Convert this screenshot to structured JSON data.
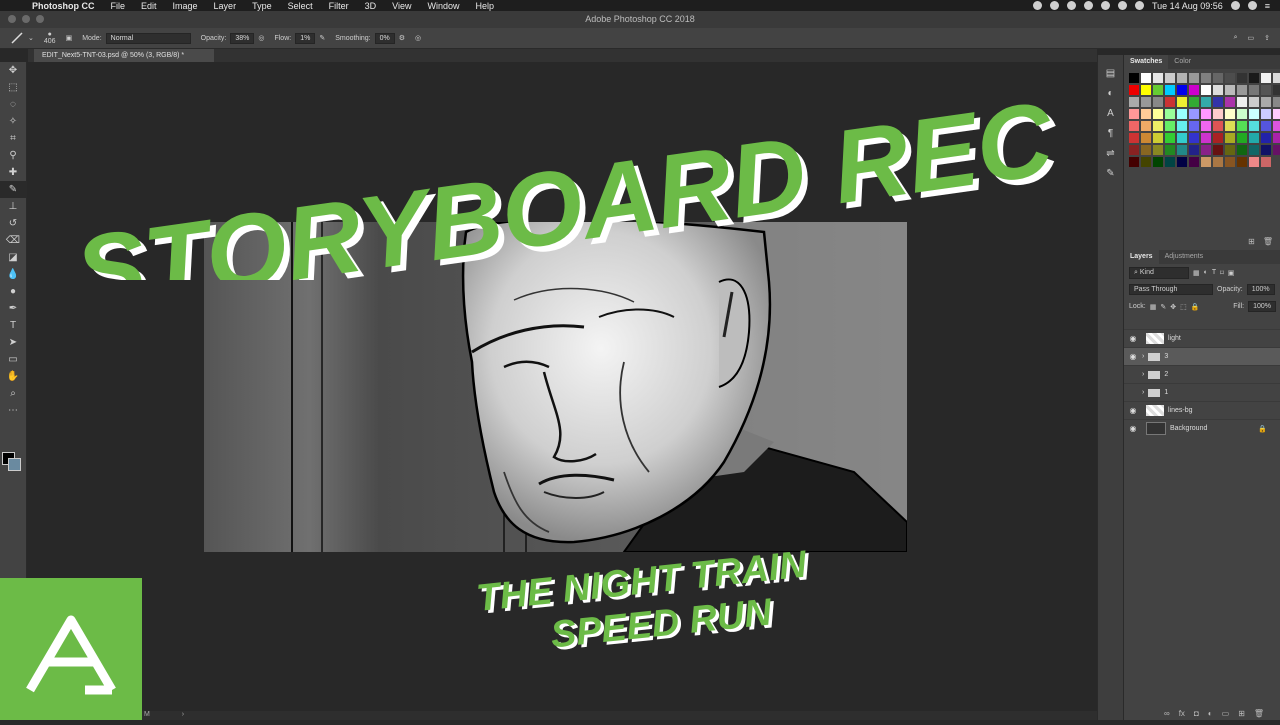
{
  "menubar": {
    "apple_icon": "apple-icon",
    "items": [
      "Photoshop CC",
      "File",
      "Edit",
      "Image",
      "Layer",
      "Type",
      "Select",
      "Filter",
      "3D",
      "View",
      "Window",
      "Help"
    ],
    "clock": "Tue 14 Aug  09:56"
  },
  "window": {
    "title": "Adobe Photoshop CC 2018"
  },
  "options": {
    "brush_size": "406",
    "mode_label": "Mode:",
    "mode_value": "Normal",
    "opacity_label": "Opacity:",
    "opacity_value": "38%",
    "flow_label": "Flow:",
    "flow_value": "1%",
    "smoothing_label": "Smoothing:",
    "smoothing_value": "0%"
  },
  "document": {
    "tab_label": "EDIT_Next5-TNT-03.psd @ 50% (3, RGB/8) *"
  },
  "overlay": {
    "headline": "STORYBOARD REC",
    "subtitle_line1": "THE NIGHT TRAIN",
    "subtitle_line2": "SPEED RUN",
    "accent_color": "#6cbb47"
  },
  "panels": {
    "swatches_tab": "Swatches",
    "color_tab": "Color",
    "layers_tab": "Layers",
    "adjustments_tab": "Adjustments",
    "kind_label": "Kind",
    "blend_mode": "Pass Through",
    "opacity_label": "Opacity:",
    "opacity_value": "100%",
    "lock_label": "Lock:",
    "fill_label": "Fill:",
    "fill_value": "100%",
    "layers": [
      {
        "name": "light",
        "visible": true,
        "type": "pixel"
      },
      {
        "name": "3",
        "visible": true,
        "type": "group",
        "selected": true
      },
      {
        "name": "2",
        "visible": false,
        "type": "group"
      },
      {
        "name": "1",
        "visible": false,
        "type": "group"
      },
      {
        "name": "lines-bg",
        "visible": true,
        "type": "pixel"
      },
      {
        "name": "Background",
        "visible": true,
        "type": "background",
        "locked": true
      }
    ]
  },
  "statusbar": {
    "text": "M"
  }
}
